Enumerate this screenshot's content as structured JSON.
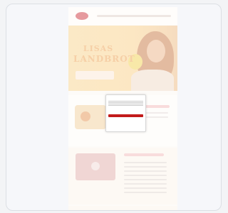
{
  "hero": {
    "title_line1": "LISAS",
    "title_line2": "LANDBROT"
  },
  "colors": {
    "brand": "#c21b1b",
    "hero_background": "#fce7c3",
    "frame_background": "#f6f7fa"
  },
  "icons": [
    "logo-icon"
  ]
}
